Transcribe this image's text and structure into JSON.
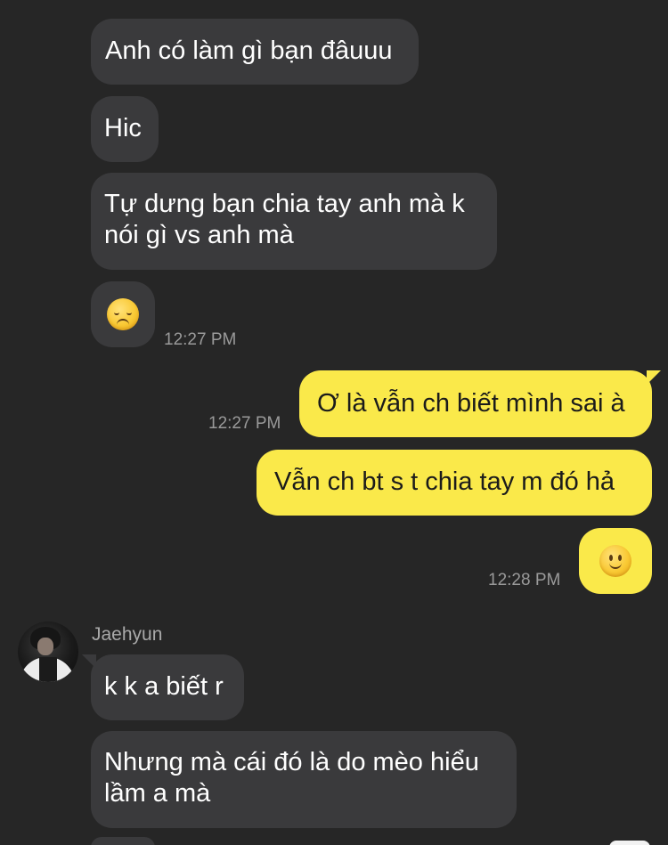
{
  "conversation": {
    "messages": [
      {
        "type": "incoming",
        "text": "Anh có làm gì bạn đâuuu"
      },
      {
        "type": "incoming",
        "text": "Hic"
      },
      {
        "type": "incoming",
        "text": "Tự dưng bạn chia tay anh mà k nói gì vs anh mà"
      },
      {
        "type": "incoming-emoji",
        "emoji": "pensive-face",
        "time": "12:27 PM"
      },
      {
        "type": "outgoing",
        "text": "Ơ là vẫn ch biết mình sai à",
        "time": "12:27 PM"
      },
      {
        "type": "outgoing",
        "text": "Vẫn ch bt s t chia tay m đó hả"
      },
      {
        "type": "outgoing-emoji",
        "emoji": "slightly-smiling-face",
        "time": "12:28 PM"
      },
      {
        "type": "incoming",
        "sender": "Jaehyun",
        "text": "k k a biết r"
      },
      {
        "type": "incoming",
        "text": "Nhưng mà cái đó là do mèo hiểu lầm a mà"
      }
    ]
  },
  "colors": {
    "background": "#262626",
    "incoming_bubble": "#3a3a3c",
    "outgoing_bubble": "#fae94a",
    "timestamp": "#9a9a9a"
  }
}
